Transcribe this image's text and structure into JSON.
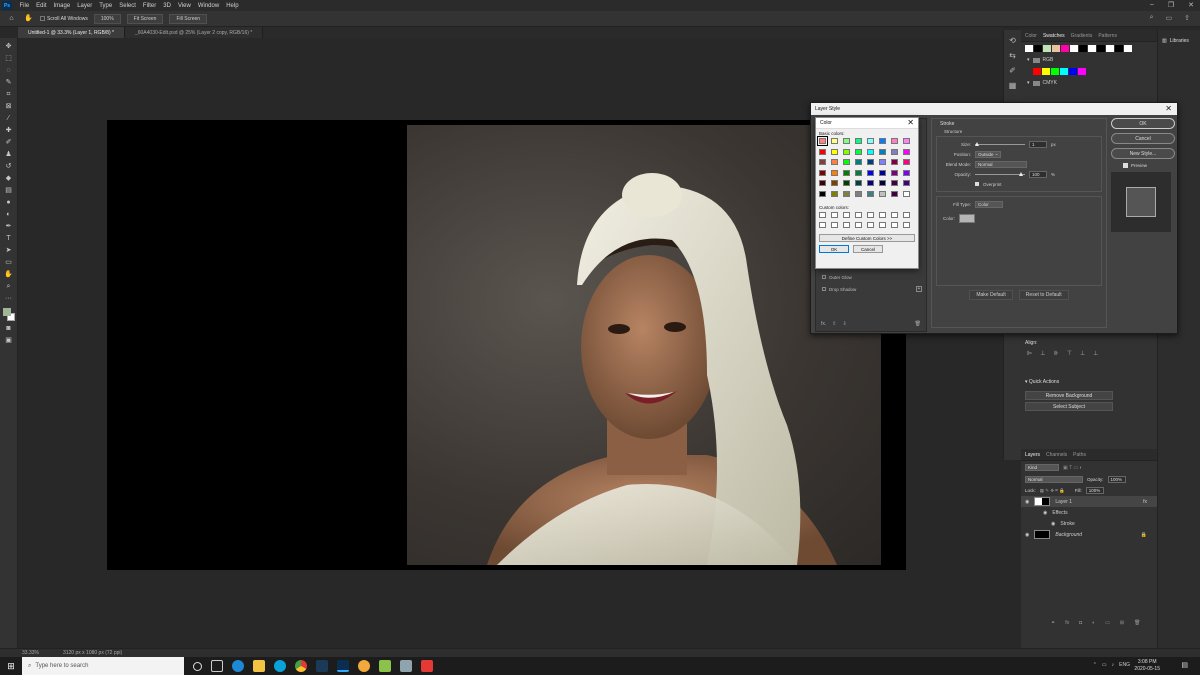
{
  "menubar": {
    "logo": "Ps",
    "items": [
      "File",
      "Edit",
      "Image",
      "Layer",
      "Type",
      "Select",
      "Filter",
      "3D",
      "View",
      "Window",
      "Help"
    ],
    "window_controls": [
      "–",
      "❐",
      "✕"
    ]
  },
  "options_bar": {
    "scroll_all": "Scroll All Windows",
    "zoom_button": "100%",
    "fit_button": "Fit Screen",
    "fill_button": "Fill Screen"
  },
  "tabs": [
    {
      "label": "Untitled-1 @ 33.3% (Layer 1, RGB/8) *",
      "active": true
    },
    {
      "label": "_60A4030-Edit.psd @ 25% (Layer 2 copy, RGB/16) *",
      "active": false
    }
  ],
  "status": {
    "zoom": "33.33%",
    "doc_size": "3120 px x 1080 px (72 ppi)"
  },
  "swatches_panel": {
    "tabs": [
      "Color",
      "Swatches",
      "Gradients",
      "Patterns"
    ],
    "active_tab": "Swatches",
    "groups": [
      "RGB",
      "CMYK"
    ],
    "top_colors": [
      "#ffffff",
      "#000000",
      "#bfe3b4",
      "#e8c3a0",
      "#ff00aa",
      "#ffffff",
      "#000000",
      "#ffffff",
      "#000000",
      "#ffffff",
      "#000000",
      "#ffffff"
    ],
    "rgb_colors": [
      "#ff0000",
      "#ffff00",
      "#00ff00",
      "#00ffff",
      "#0000ff",
      "#ff00ff"
    ]
  },
  "libraries": {
    "label": "Libraries"
  },
  "align_label": "Align:",
  "quick_actions": {
    "title": "Quick Actions",
    "buttons": [
      "Remove Background",
      "Select Subject"
    ]
  },
  "layers_panel": {
    "tabs": [
      "Layers",
      "Channels",
      "Paths"
    ],
    "kind": "Kind",
    "blend": "Normal",
    "opacity_label": "Opacity:",
    "opacity": "100%",
    "lock_label": "Lock:",
    "fill_label": "Fill:",
    "fill": "100%",
    "layers": [
      {
        "name": "Layer 1",
        "selected": true,
        "fx": "fx"
      },
      {
        "name": "Effects",
        "sub": true
      },
      {
        "name": "Stroke",
        "sub": true
      },
      {
        "name": "Background",
        "selected": false
      }
    ]
  },
  "layer_style": {
    "title": "Layer Style",
    "section": "Stroke",
    "structure": "Structure",
    "size_label": "Size:",
    "size": "1",
    "size_unit": "px",
    "position_label": "Position:",
    "position": "Outside",
    "blend_label": "Blend Mode:",
    "blend": "Normal",
    "opacity_label": "Opacity:",
    "opacity": "100",
    "opacity_unit": "%",
    "overprint": "Overprint",
    "fill_type_label": "Fill Type:",
    "fill_type": "Color",
    "color_label": "Color:",
    "make_default": "Make Default",
    "reset_default": "Reset to Default",
    "ok": "OK",
    "cancel": "Cancel",
    "new_style": "New Style...",
    "preview": "Preview",
    "left_items": [
      "Outer Glow",
      "Drop Shadow"
    ],
    "fx": "fx."
  },
  "color_dialog": {
    "title": "Color",
    "basic_label": "Basic colors:",
    "custom_label": "Custom colors:",
    "define_button": "Define Custom Colors >>",
    "ok": "OK",
    "cancel": "Cancel",
    "basic_colors": [
      "#ff8080",
      "#ffff80",
      "#80ff80",
      "#00ff80",
      "#80ffff",
      "#0080ff",
      "#ff80c0",
      "#ff80ff",
      "#ff0000",
      "#ffff00",
      "#80ff00",
      "#00ff40",
      "#00ffff",
      "#0080c0",
      "#8080c0",
      "#ff00ff",
      "#804040",
      "#ff8040",
      "#00ff00",
      "#008080",
      "#004080",
      "#8080ff",
      "#800040",
      "#ff0080",
      "#800000",
      "#ff8000",
      "#008000",
      "#008040",
      "#0000ff",
      "#0000a0",
      "#800080",
      "#8000ff",
      "#400000",
      "#804000",
      "#004000",
      "#004040",
      "#000080",
      "#000040",
      "#400040",
      "#400080",
      "#000000",
      "#808000",
      "#808040",
      "#808080",
      "#408080",
      "#c0c0c0",
      "#400040",
      "#ffffff"
    ]
  },
  "taskbar": {
    "search_placeholder": "Type here to search",
    "lang": "ENG",
    "time": "3:08 PM",
    "date": "2020-05-15"
  }
}
